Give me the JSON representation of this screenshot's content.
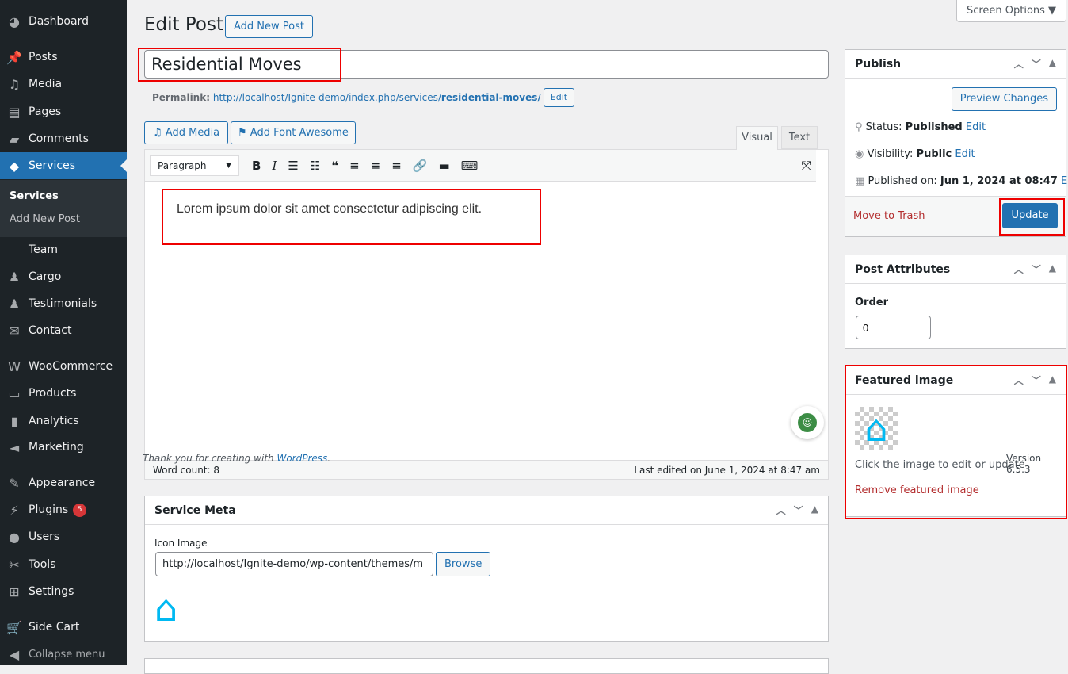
{
  "sidebar": {
    "items": [
      {
        "label": "Dashboard",
        "icon": "dashboard-icon",
        "glyph": "◕"
      },
      {
        "label": "Posts",
        "icon": "pin-icon",
        "glyph": "📌"
      },
      {
        "label": "Media",
        "icon": "media-icon",
        "glyph": "♫"
      },
      {
        "label": "Pages",
        "icon": "pages-icon",
        "glyph": "▤"
      },
      {
        "label": "Comments",
        "icon": "comment-icon",
        "glyph": "▰"
      },
      {
        "label": "Services",
        "icon": "tag-icon",
        "glyph": "◆"
      },
      {
        "label": "Team",
        "icon": "",
        "glyph": ""
      },
      {
        "label": "Cargo",
        "icon": "person-icon",
        "glyph": "♟"
      },
      {
        "label": "Testimonials",
        "icon": "person-icon",
        "glyph": "♟"
      },
      {
        "label": "Contact",
        "icon": "mail-icon",
        "glyph": "✉"
      },
      {
        "label": "WooCommerce",
        "icon": "woo-icon",
        "glyph": "W"
      },
      {
        "label": "Products",
        "icon": "archive-icon",
        "glyph": "▭"
      },
      {
        "label": "Analytics",
        "icon": "bar-chart-icon",
        "glyph": "▮"
      },
      {
        "label": "Marketing",
        "icon": "megaphone-icon",
        "glyph": "◄"
      },
      {
        "label": "Appearance",
        "icon": "brush-icon",
        "glyph": "✎"
      },
      {
        "label": "Plugins",
        "icon": "plug-icon",
        "glyph": "⚡",
        "badge": "5"
      },
      {
        "label": "Users",
        "icon": "user-icon",
        "glyph": "●"
      },
      {
        "label": "Tools",
        "icon": "wrench-icon",
        "glyph": "✂"
      },
      {
        "label": "Settings",
        "icon": "settings-icon",
        "glyph": "⊞"
      },
      {
        "label": "Side Cart",
        "icon": "cart-icon",
        "glyph": "🛒"
      }
    ],
    "submenu": [
      "Services",
      "Add New Post"
    ],
    "collapse": "Collapse menu"
  },
  "header": {
    "title": "Edit Post",
    "add_new": "Add New Post",
    "screen_options": "Screen Options ▼"
  },
  "post": {
    "title": "Residential Moves",
    "permalink_label": "Permalink:",
    "permalink_base": "http://localhost/Ignite-demo/index.php/services/",
    "permalink_slug": "residential-moves/",
    "permalink_edit": "Edit"
  },
  "editor": {
    "add_media": "Add Media",
    "add_font_awesome": "Add Font Awesome",
    "tab_visual": "Visual",
    "tab_text": "Text",
    "format": "Paragraph",
    "content": "Lorem ipsum dolor sit amet consectetur adipiscing elit.",
    "word_count": "Word count: 8",
    "last_edited": "Last edited on June 1, 2024 at 8:47 am",
    "thank_you": "Thank you for creating with ",
    "wordpress": "WordPress",
    "period": "."
  },
  "service_meta": {
    "title": "Service Meta",
    "icon_label": "Icon Image",
    "icon_url": "http://localhost/Ignite-demo/wp-content/themes/m",
    "browse": "Browse"
  },
  "publish": {
    "title": "Publish",
    "preview": "Preview Changes",
    "status_label": "Status: ",
    "status": "Published",
    "visibility_label": "Visibility: ",
    "visibility": "Public",
    "published_label": "Published on: ",
    "published": "Jun 1, 2024 at 08:47",
    "edit": "Edit",
    "trash": "Move to Trash",
    "update": "Update"
  },
  "attributes": {
    "title": "Post Attributes",
    "order_label": "Order",
    "order": "0"
  },
  "featured": {
    "title": "Featured image",
    "hint": "Click the image to edit or update",
    "remove": "Remove featured image",
    "version": "Version 6.5.3"
  },
  "colors": {
    "accent": "#2271b1",
    "icon_blue": "#00b9f2",
    "highlight": "#ee0000"
  }
}
